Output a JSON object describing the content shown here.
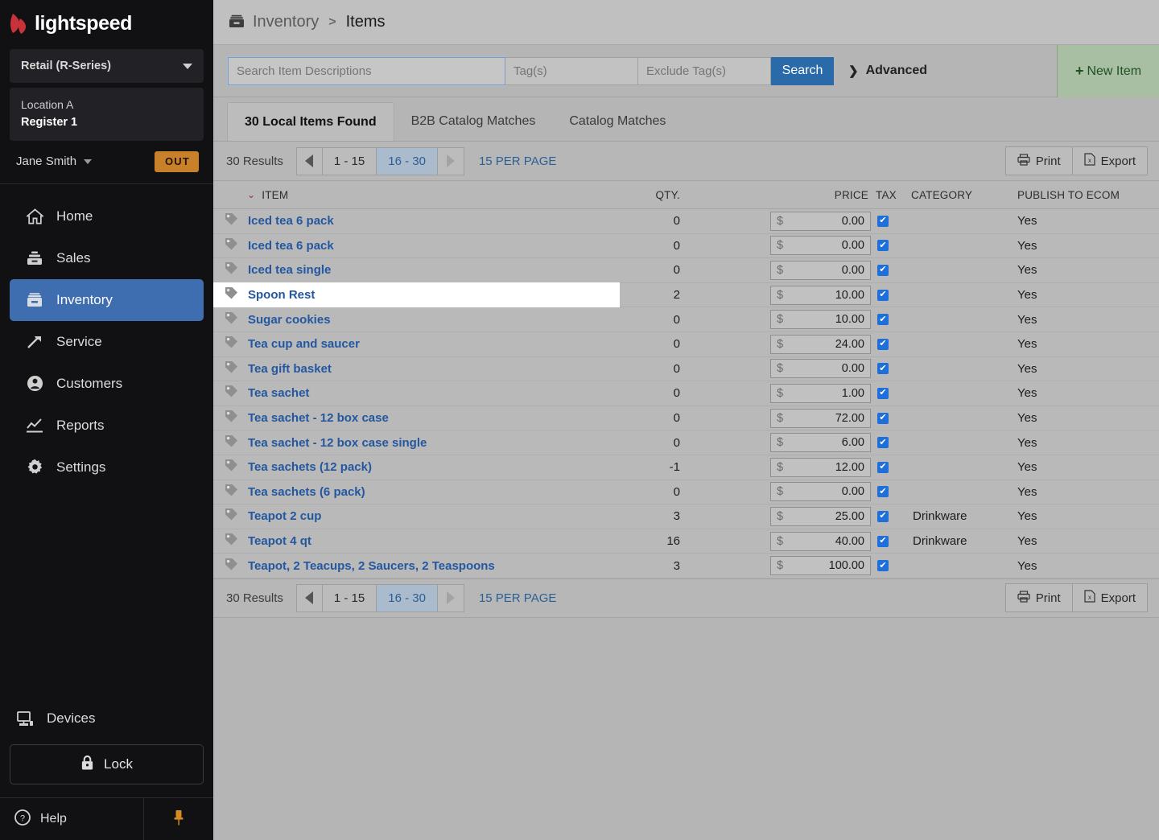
{
  "sidebar": {
    "brand": "lightspeed",
    "product_picker": "Retail (R-Series)",
    "location": "Location A",
    "register": "Register 1",
    "user": "Jane Smith",
    "clock_badge": "OUT",
    "nav": [
      {
        "label": "Home",
        "icon": "home-icon",
        "active": false
      },
      {
        "label": "Sales",
        "icon": "sales-icon",
        "active": false
      },
      {
        "label": "Inventory",
        "icon": "inventory-icon",
        "active": true
      },
      {
        "label": "Service",
        "icon": "service-icon",
        "active": false
      },
      {
        "label": "Customers",
        "icon": "customers-icon",
        "active": false
      },
      {
        "label": "Reports",
        "icon": "reports-icon",
        "active": false
      },
      {
        "label": "Settings",
        "icon": "settings-icon",
        "active": false
      }
    ],
    "devices": "Devices",
    "lock": "Lock",
    "help": "Help",
    "pin_icon": "pushpin-icon",
    "accent": "#3f6eb0",
    "badge_color": "#c8802a"
  },
  "breadcrumb": {
    "icon": "inventory-box-icon",
    "parent": "Inventory",
    "separator": ">",
    "current": "Items"
  },
  "search": {
    "query_placeholder": "Search Item Descriptions",
    "query_value": "",
    "tags_placeholder": "Tag(s)",
    "tags_value": "",
    "exclude_tags_placeholder": "Exclude Tag(s)",
    "exclude_tags_value": "",
    "search_button": "Search",
    "advanced": "Advanced",
    "advanced_chevron": "❯",
    "new_item": "New Item",
    "new_item_plus": "+"
  },
  "tabs": [
    {
      "label": "30 Local Items Found",
      "active": true
    },
    {
      "label": "B2B Catalog Matches",
      "active": false
    },
    {
      "label": "Catalog Matches",
      "active": false
    }
  ],
  "pagination": {
    "results": "30 Results",
    "prev_icon": "triangle-left-icon",
    "next_icon": "triangle-right-icon",
    "pages": [
      "1 - 15",
      "16 - 30"
    ],
    "selected_page": "16 - 30",
    "per_page": "15 PER PAGE",
    "print": "Print",
    "export": "Export",
    "print_icon": "printer-icon",
    "export_icon": "excel-file-icon"
  },
  "table": {
    "sort_indicator": "⌄",
    "columns": [
      "ITEM",
      "QTY.",
      "PRICE",
      "TAX",
      "CATEGORY",
      "PUBLISH TO ECOM"
    ],
    "checkbox_glyph": "✔",
    "currency_symbol": "$",
    "rows": [
      {
        "item": "Iced tea 6 pack",
        "qty": "0",
        "price": "0.00",
        "tax": true,
        "category": "",
        "ecom": "Yes",
        "highlighted": false
      },
      {
        "item": "Iced tea 6 pack",
        "qty": "0",
        "price": "0.00",
        "tax": true,
        "category": "",
        "ecom": "Yes",
        "highlighted": false
      },
      {
        "item": "Iced tea single",
        "qty": "0",
        "price": "0.00",
        "tax": true,
        "category": "",
        "ecom": "Yes",
        "highlighted": false
      },
      {
        "item": "Spoon Rest",
        "qty": "2",
        "price": "10.00",
        "tax": true,
        "category": "",
        "ecom": "Yes",
        "highlighted": true
      },
      {
        "item": "Sugar cookies",
        "qty": "0",
        "price": "10.00",
        "tax": true,
        "category": "",
        "ecom": "Yes",
        "highlighted": false
      },
      {
        "item": "Tea cup and saucer",
        "qty": "0",
        "price": "24.00",
        "tax": true,
        "category": "",
        "ecom": "Yes",
        "highlighted": false
      },
      {
        "item": "Tea gift basket",
        "qty": "0",
        "price": "0.00",
        "tax": true,
        "category": "",
        "ecom": "Yes",
        "highlighted": false
      },
      {
        "item": "Tea sachet",
        "qty": "0",
        "price": "1.00",
        "tax": true,
        "category": "",
        "ecom": "Yes",
        "highlighted": false
      },
      {
        "item": "Tea sachet - 12 box case",
        "qty": "0",
        "price": "72.00",
        "tax": true,
        "category": "",
        "ecom": "Yes",
        "highlighted": false
      },
      {
        "item": "Tea sachet - 12 box case single",
        "qty": "0",
        "price": "6.00",
        "tax": true,
        "category": "",
        "ecom": "Yes",
        "highlighted": false
      },
      {
        "item": "Tea sachets (12 pack)",
        "qty": "-1",
        "price": "12.00",
        "tax": true,
        "category": "",
        "ecom": "Yes",
        "highlighted": false
      },
      {
        "item": "Tea sachets (6 pack)",
        "qty": "0",
        "price": "0.00",
        "tax": true,
        "category": "",
        "ecom": "Yes",
        "highlighted": false
      },
      {
        "item": "Teapot 2 cup",
        "qty": "3",
        "price": "25.00",
        "tax": true,
        "category": "Drinkware",
        "ecom": "Yes",
        "highlighted": false
      },
      {
        "item": "Teapot 4 qt",
        "qty": "16",
        "price": "40.00",
        "tax": true,
        "category": "Drinkware",
        "ecom": "Yes",
        "highlighted": false
      },
      {
        "item": "Teapot, 2 Teacups, 2 Saucers, 2 Teaspoons",
        "qty": "3",
        "price": "100.00",
        "tax": true,
        "category": "",
        "ecom": "Yes",
        "highlighted": false
      }
    ]
  },
  "colors": {
    "sidebar_bg": "#111113",
    "sidebar_active": "#3f6eb0",
    "page_bg": "#b5b5b5",
    "link_blue": "#2357a0",
    "search_blue": "#2a6aa8",
    "new_item_green": "#a9bfa4",
    "checkbox_blue": "#1e6fd9"
  }
}
